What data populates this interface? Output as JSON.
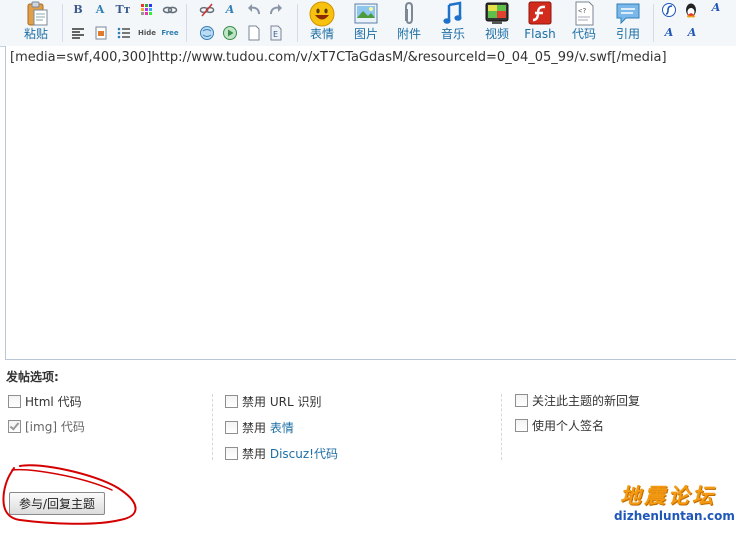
{
  "toolbar": {
    "paste_label": "粘贴",
    "small_row1": [
      "B",
      "A",
      "Tт",
      "",
      ""
    ],
    "small_row2_text": [
      "Hide",
      "Free"
    ],
    "big_buttons": [
      {
        "label": "表情",
        "icon": "smiley-icon"
      },
      {
        "label": "图片",
        "icon": "image-icon"
      },
      {
        "label": "附件",
        "icon": "paperclip-icon"
      },
      {
        "label": "音乐",
        "icon": "music-note-icon"
      },
      {
        "label": "视频",
        "icon": "video-icon"
      },
      {
        "label": "Flash",
        "icon": "flash-icon"
      },
      {
        "label": "代码",
        "icon": "code-icon"
      },
      {
        "label": "引用",
        "icon": "quote-icon"
      }
    ],
    "right_glyphs": [
      "A",
      "A",
      "A",
      "A"
    ]
  },
  "editor": {
    "content": "[media=swf,400,300]http://www.tudou.com/v/xT7CTaGdasM/&resourceId=0_04_05_99/v.swf[/media]"
  },
  "options": {
    "title": "发帖选项:",
    "col1": [
      {
        "label": "Html 代码",
        "checked": false
      },
      {
        "label": "[img] 代码",
        "checked": true
      }
    ],
    "col2": [
      {
        "prefix": "禁用 ",
        "label": "URL 识别"
      },
      {
        "prefix": "禁用 ",
        "label": "表情"
      },
      {
        "prefix": "禁用 ",
        "label": "Discuz!代码"
      }
    ],
    "col3": [
      {
        "label": "关注此主题的新回复"
      },
      {
        "label": "使用个人签名"
      }
    ]
  },
  "submit": {
    "label": "参与/回复主题"
  },
  "watermark": {
    "cn": "地震论坛",
    "en": "dizhenluntan.com"
  },
  "colors": {
    "link": "#1c6ea4",
    "annotation": "#d40000",
    "watermark_orange": "#f39a12",
    "watermark_blue": "#1f57b8"
  }
}
